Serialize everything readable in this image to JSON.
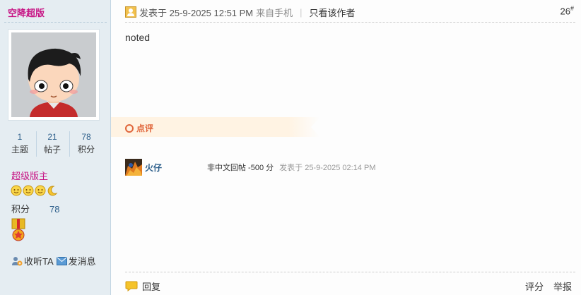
{
  "sidebar": {
    "username": "空降超版",
    "stats": [
      {
        "value": "1",
        "label": "主题"
      },
      {
        "value": "21",
        "label": "帖子"
      },
      {
        "value": "78",
        "label": "积分"
      }
    ],
    "group_name": "超级版主",
    "level_icons": [
      "sun-icon",
      "sun-icon",
      "sun-icon",
      "moon-icon"
    ],
    "credit_label": "积分",
    "credit_value": "78",
    "medal_icon": "medal-icon",
    "follow_label": "收听TA",
    "message_label": "发消息"
  },
  "post": {
    "posted_label": "发表于 25-9-2025 12:51 PM",
    "source": "来自手机",
    "separator": "|",
    "only_author": "只看该作者",
    "floor": "26",
    "floor_mark": "#",
    "body": "noted",
    "comment_label": "点评",
    "comment": {
      "user": "火仔",
      "text": "非中文回帖 -500 分",
      "time": "发表于 25-9-2025 02:14 PM"
    },
    "reply_label": "回复",
    "rate_label": "评分",
    "report_label": "举报"
  },
  "colors": {
    "sidebar_bg": "#E5EDF2",
    "accent_pink": "#C71585",
    "link_blue": "#2D5F8B",
    "comment_orange": "#E0653A",
    "comment_bar_bg": "#FFF3E3"
  }
}
